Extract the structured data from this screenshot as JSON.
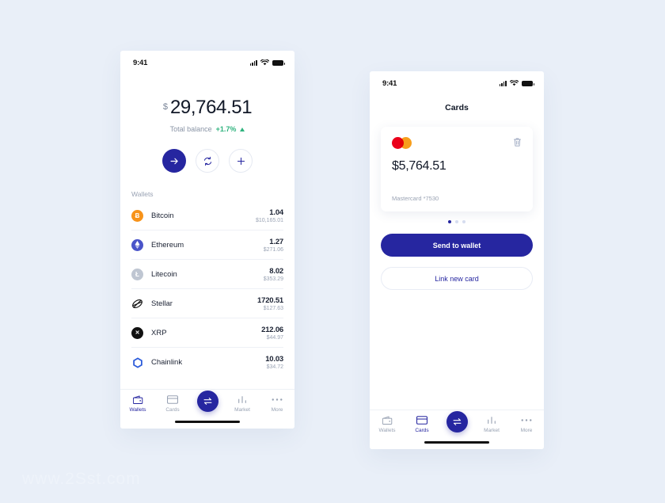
{
  "accent": "#2626a0",
  "background": "#e9eff8",
  "watermark": "www.2Sst.com",
  "wallets_screen": {
    "status": {
      "time": "9:41",
      "signal_icon": "signal-bars-icon",
      "wifi_icon": "wifi-icon",
      "battery_icon": "battery-icon"
    },
    "balance": {
      "currency_symbol": "$",
      "amount": "29,764.51",
      "caption": "Total balance",
      "change": "+1.7%",
      "change_color": "#2fb37e",
      "trend_icon": "triangle-up-icon"
    },
    "actions": [
      {
        "name": "send-button",
        "icon": "arrow-right-icon",
        "style": "primary"
      },
      {
        "name": "exchange-button",
        "icon": "refresh-swap-icon",
        "style": "ghost"
      },
      {
        "name": "add-button",
        "icon": "plus-icon",
        "style": "ghost"
      }
    ],
    "list_label": "Wallets",
    "wallets": [
      {
        "name": "Bitcoin",
        "icon": "bitcoin-icon",
        "glyph": "Ƀ",
        "color": "#f7931a",
        "amount": "1.04",
        "fiat": "$10,165.01"
      },
      {
        "name": "Ethereum",
        "icon": "ethereum-icon",
        "glyph": "♦",
        "color": "#4a54c9",
        "amount": "1.27",
        "fiat": "$271.06"
      },
      {
        "name": "Litecoin",
        "icon": "litecoin-icon",
        "glyph": "Ł",
        "color": "#bfc6d2",
        "amount": "8.02",
        "fiat": "$353.29"
      },
      {
        "name": "Stellar",
        "icon": "stellar-icon",
        "glyph": "✦",
        "color": "#ffffff",
        "amount": "1720.51",
        "fiat": "$127.63"
      },
      {
        "name": "XRP",
        "icon": "xrp-icon",
        "glyph": "✕",
        "color": "#111111",
        "amount": "212.06",
        "fiat": "$44.97"
      },
      {
        "name": "Chainlink",
        "icon": "chainlink-icon",
        "glyph": "⬡",
        "color": "#ffffff",
        "amount": "10.03",
        "fiat": "$34.72"
      }
    ],
    "tabs": [
      {
        "label": "Wallets",
        "icon": "wallet-icon",
        "active": true
      },
      {
        "label": "Cards",
        "icon": "card-icon",
        "active": false
      },
      {
        "label": "",
        "icon": "exchange-icon",
        "active": false,
        "fab": true
      },
      {
        "label": "Market",
        "icon": "market-bars-icon",
        "active": false
      },
      {
        "label": "More",
        "icon": "ellipsis-icon",
        "active": false
      }
    ]
  },
  "cards_screen": {
    "status": {
      "time": "9:41",
      "signal_icon": "signal-bars-icon",
      "wifi_icon": "wifi-icon",
      "battery_icon": "battery-icon"
    },
    "title": "Cards",
    "card": {
      "brand_icon": "mastercard-icon",
      "delete_icon": "trash-icon",
      "balance": "$5,764.51",
      "meta": "Mastercard *7530"
    },
    "pagination": {
      "count": 3,
      "active_index": 0
    },
    "primary_button": "Send to wallet",
    "secondary_button": "Link new card",
    "tabs": [
      {
        "label": "Wallets",
        "icon": "wallet-icon",
        "active": false
      },
      {
        "label": "Cards",
        "icon": "card-icon",
        "active": true
      },
      {
        "label": "",
        "icon": "exchange-icon",
        "active": false,
        "fab": true
      },
      {
        "label": "Market",
        "icon": "market-bars-icon",
        "active": false
      },
      {
        "label": "More",
        "icon": "ellipsis-icon",
        "active": false
      }
    ]
  }
}
